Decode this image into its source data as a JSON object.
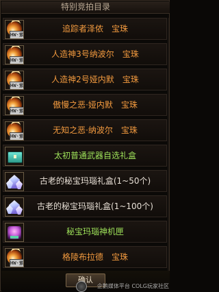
{
  "window": {
    "title": "特别竞拍目录"
  },
  "items": [
    {
      "name": "追踪者泽侬　宝珠",
      "color": "orange",
      "icon": "fire-orb-icon",
      "tag": "HW·紫"
    },
    {
      "name": "人造神3号纳波尔　宝珠",
      "color": "orange",
      "icon": "fire-orb-icon",
      "tag": "HW·紫"
    },
    {
      "name": "人造神2号娅内默　宝珠",
      "color": "orange",
      "icon": "fire-orb-icon",
      "tag": "HW·紫"
    },
    {
      "name": "傲慢之恶·娅内默　宝珠",
      "color": "orange",
      "icon": "fire-orb-icon",
      "tag": "HW·紫"
    },
    {
      "name": "无知之恶·纳波尔　宝珠",
      "color": "orange",
      "icon": "fire-orb-icon",
      "tag": "HW·紫"
    },
    {
      "name": "太初普通武器自选礼盒",
      "color": "green",
      "icon": "gift-box-icon"
    },
    {
      "name": "古老的秘宝玛瑙礼盒(1~50个)",
      "color": "white",
      "icon": "crystal-icon"
    },
    {
      "name": "古老的秘宝玛瑙礼盒(1~100个)",
      "color": "white",
      "icon": "crystal-icon"
    },
    {
      "name": "秘宝玛瑙神机匣",
      "color": "green",
      "icon": "machine-icon"
    },
    {
      "name": "格陵布拉德　宝珠",
      "color": "orange",
      "icon": "fire-orb-icon",
      "tag": "HW·紫"
    }
  ],
  "footer": {
    "confirm_label": "确认",
    "watermark": "企鹅媒体平台 COLG玩家社区"
  },
  "colors": {
    "orange": "#f29a3f",
    "green": "#9fe35a",
    "white": "#e8e0d6"
  }
}
